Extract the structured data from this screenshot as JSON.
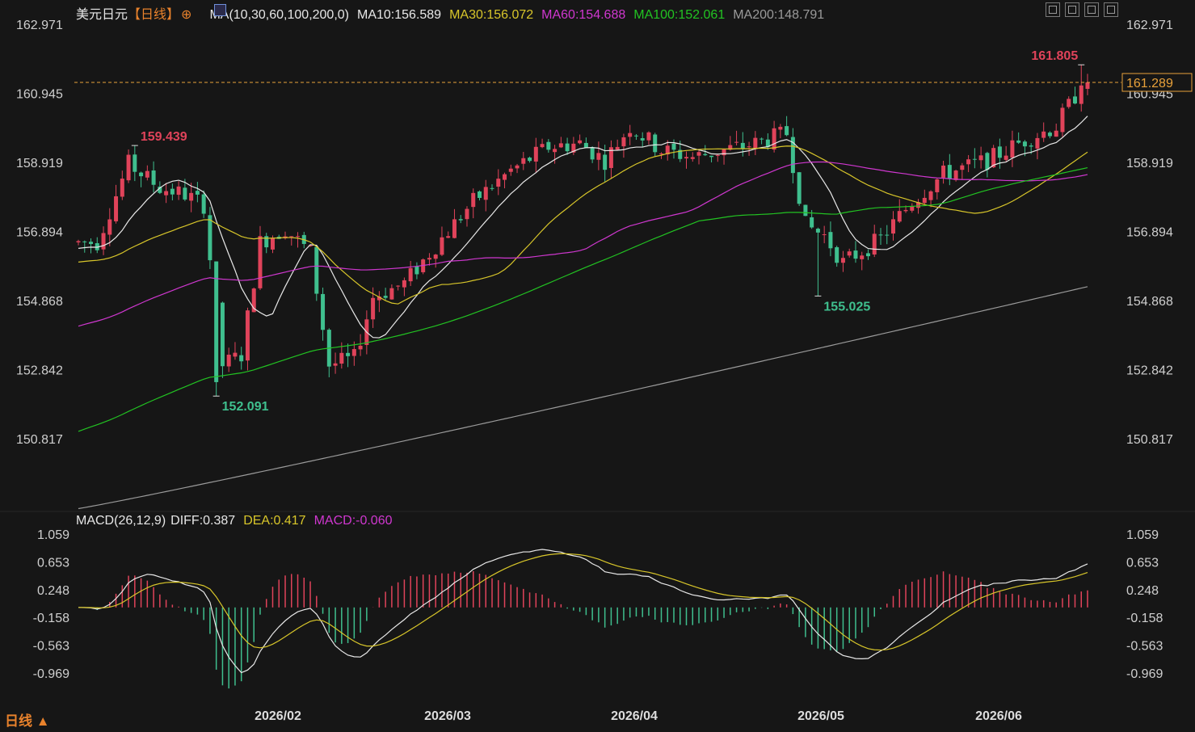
{
  "header": {
    "symbol": "美元日元",
    "period_tag": "【日线】",
    "ma_params": "MA(10,30,60,100,200,0)",
    "ma10": "MA10:156.589",
    "ma30": "MA30:156.072",
    "ma60": "MA60:154.688",
    "ma100": "MA100:152.061",
    "ma200": "MA200:148.791"
  },
  "colors": {
    "bg": "#161616",
    "up": "#e0435a",
    "down": "#3fbf8e",
    "ma10": "#e8e8e8",
    "ma30": "#d8c62a",
    "ma60": "#cf37cf",
    "ma100": "#22c322",
    "ma200": "#9a9a9a",
    "price_line": "#e8a13a",
    "axis_text": "#cfcfcf",
    "hi_label": "#e0435a",
    "lo_label": "#3fbf8e",
    "diff": "#e8e8e8",
    "dea": "#d8c62a",
    "macd_text": "#cf37cf"
  },
  "price_axis": {
    "labels": [
      "162.971",
      "160.945",
      "158.919",
      "156.894",
      "154.868",
      "152.842",
      "150.817"
    ]
  },
  "current_price": "161.289",
  "annotations": {
    "high_label": "161.805",
    "local_high_label": "159.439",
    "low_label": "152.091",
    "local_low_label": "155.025"
  },
  "macd": {
    "params": "MACD(26,12,9)",
    "diff": "DIFF:0.387",
    "dea": "DEA:0.417",
    "macd": "MACD:-0.060",
    "axis_labels": [
      "1.059",
      "0.653",
      "0.248",
      "-0.158",
      "-0.563",
      "-0.969"
    ]
  },
  "time_axis": {
    "labels": [
      "2026/02",
      "2026/03",
      "2026/04",
      "2026/05",
      "2026/06"
    ]
  },
  "footer": {
    "period_button": "日线 ▲"
  },
  "toolbar": {
    "icons": [
      "grid-icon",
      "single-chart-icon",
      "play-icon",
      "compare-icon"
    ]
  },
  "chart_data": {
    "type": "candlestick",
    "title": "美元日元【日线】",
    "ylim": [
      150.0,
      163.6
    ],
    "key_points": {
      "high": 161.805,
      "local_high": 159.439,
      "low": 152.091,
      "local_low": 155.025,
      "last": 161.289
    },
    "ma_last": {
      "MA10": 156.589,
      "MA30": 156.072,
      "MA60": 154.688,
      "MA100": 152.061,
      "MA200": 148.791
    },
    "macd_last": {
      "DIFF": 0.387,
      "DEA": 0.417,
      "MACD": -0.06
    },
    "macd_ylim": [
      -1.25,
      1.15
    ]
  }
}
